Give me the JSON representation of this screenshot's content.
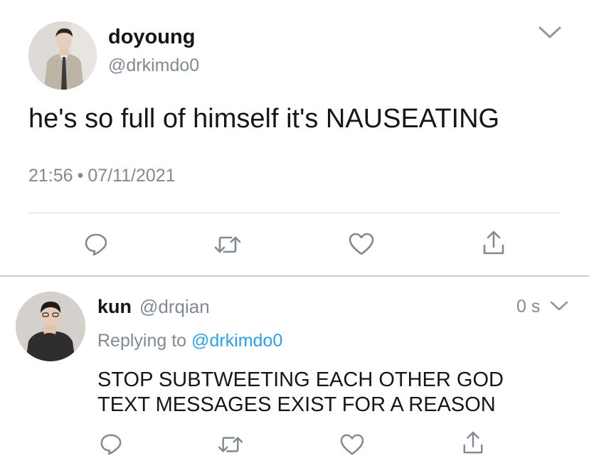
{
  "main_tweet": {
    "display_name": "doyoung",
    "handle": "@drkimdo0",
    "text": "he's so full of himself it's NAUSEATING",
    "time": "21:56",
    "separator": "•",
    "date": "07/11/2021"
  },
  "reply_tweet": {
    "display_name": "kun",
    "handle": "@drqian",
    "timestamp": "0 s",
    "replying_prefix": "Replying to",
    "replying_mention": "@drkimdo0",
    "text_line1": "STOP SUBTWEETING EACH OTHER GOD",
    "text_line2": "TEXT MESSAGES EXIST FOR A REASON"
  },
  "icons": {
    "reply": "reply-icon",
    "retweet": "retweet-icon",
    "like": "heart-icon",
    "share": "share-icon",
    "more": "chevron-down-icon"
  },
  "colors": {
    "icon_gray": "#7f8a95",
    "link_blue": "#2aa0ef",
    "text_dark": "#14171a",
    "divider": "#d6dbe0"
  }
}
